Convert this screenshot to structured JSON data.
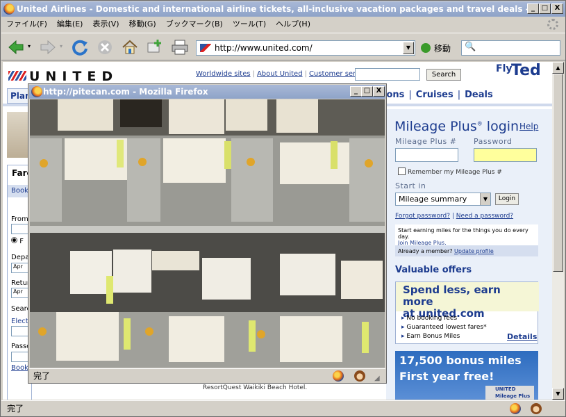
{
  "window": {
    "title": "United Airlines - Domestic and international airline tickets, all-inclusive vacation packages and travel deals - Mozill",
    "minimize": "_",
    "maximize": "□",
    "close": "X"
  },
  "menu": [
    "ファイル(F)",
    "編集(E)",
    "表示(V)",
    "移動(G)",
    "ブックマーク(B)",
    "ツール(T)",
    "ヘルプ(H)"
  ],
  "toolbar": {
    "url": "http://www.united.com/",
    "go_label": "移動",
    "icons": [
      "back-icon",
      "forward-icon",
      "reload-icon",
      "stop-icon",
      "home-icon",
      "bookmark-add-icon",
      "print-icon"
    ]
  },
  "status_bar": {
    "text": "完了"
  },
  "united": {
    "logo": "UNITED",
    "top_links": [
      "Worldwide sites",
      "About United",
      "Customer service"
    ],
    "search_button": "Search",
    "fly": "Fly",
    "ted": "Ted",
    "nav_tab": "Plan",
    "nav_links": [
      "ions",
      "Cruises",
      "Deals"
    ],
    "fare_header": "Fare",
    "book_tab": "Book",
    "fare_labels": {
      "from": "From",
      "depart": "Depar",
      "return": "Retur",
      "search": "Searc",
      "electronic": "Electr",
      "passengers": "Passe",
      "book_link": "Book"
    },
    "fare_select_apr": "Apr",
    "radio_label": "F",
    "mid_text": "ResortQuest Waikiki Beach Hotel.",
    "mileage": {
      "title": "Mileage Plus",
      "title_suffix": " login",
      "reg": "®",
      "help": "Help",
      "num_label": "Mileage Plus #",
      "pw_label": "Password",
      "remember": "Remember my Mileage Plus #",
      "start_in": "Start in",
      "start_value": "Mileage summary",
      "login_button": "Login",
      "forgot": "Forgot password?",
      "need": "Need a password?",
      "earn_text": "Start earning miles for the things you do every day.",
      "join": "Join Mileage Plus.",
      "already": "Already a member?",
      "update": "Update profile"
    },
    "valuable_offers": "Valuable offers",
    "offer1": {
      "headline1": "Spend less, earn more",
      "headline2_prefix": "at ",
      "headline2": "united.com",
      "bullets": [
        "No booking fees",
        "Guaranteed lowest fares*",
        "Earn Bonus Miles"
      ],
      "details": "Details"
    },
    "offer2": {
      "headline": "17,500 bonus miles",
      "subline": "First year free!",
      "card_text": "UNITED Mileage Plus"
    }
  },
  "popup": {
    "title": "http://pitecan.com - Mozilla Firefox",
    "status": "完了"
  },
  "colors": {
    "united_blue": "#1d3c8f",
    "titlebar": "#8ea3c8",
    "password_bg": "#ffff9c"
  }
}
